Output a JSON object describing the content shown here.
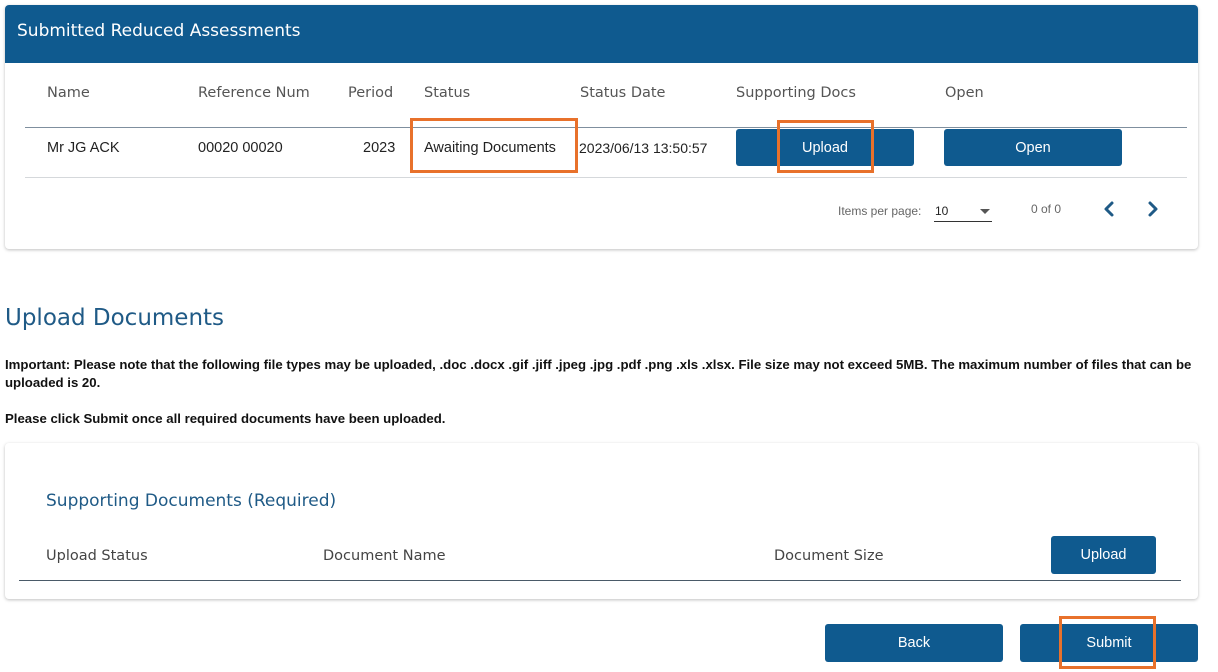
{
  "assessments": {
    "title": "Submitted Reduced Assessments",
    "columns": [
      "Name",
      "Reference Num",
      "Period",
      "Status",
      "Status Date",
      "Supporting Docs",
      "Open"
    ],
    "rows": [
      {
        "name": "Mr JG ACK",
        "reference": "00020 00020",
        "period": "2023",
        "status": "Awaiting Documents",
        "status_date": "2023/06/13 13:50:57",
        "upload_label": "Upload",
        "open_label": "Open"
      }
    ],
    "pager": {
      "items_per_page_label": "Items per page:",
      "items_per_page_value": "10",
      "range": "0 of 0"
    }
  },
  "upload": {
    "title": "Upload Documents",
    "note_important": "Important: Please note that the following file types may be uploaded, .doc .docx .gif .jiff .jpeg .jpg .pdf .png .xls .xlsx. File size may not exceed 5MB. The maximum number of files that can be uploaded is 20.",
    "note_submit": "Please click Submit once all required documents have been uploaded.",
    "supporting": {
      "title": "Supporting Documents (Required)",
      "columns": [
        "Upload Status",
        "Document Name",
        "Document Size"
      ],
      "upload_label": "Upload"
    },
    "back_label": "Back",
    "submit_label": "Submit"
  },
  "colors": {
    "primary": "#0f5a8f",
    "highlight": "#e8712b",
    "heading": "#1f5a86"
  }
}
